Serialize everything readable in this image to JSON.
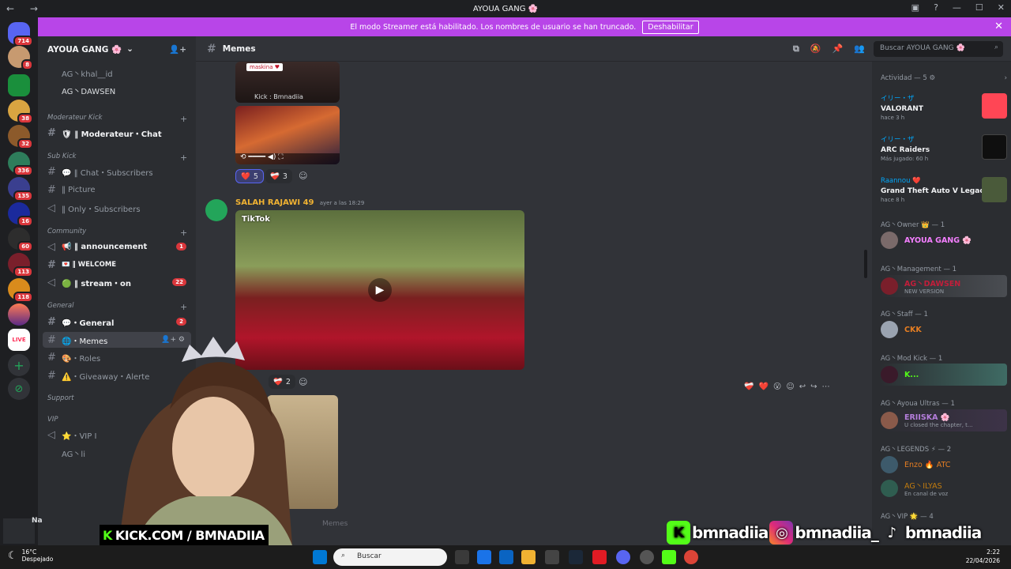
{
  "window": {
    "title": "AYOUA GANG 🌸",
    "nav": "← →",
    "controls": [
      "▣",
      "?",
      "—",
      "☐",
      "✕"
    ]
  },
  "server_badges": [
    "714",
    "8",
    "38",
    "32",
    "336",
    "135",
    "16",
    "60",
    "113",
    "118"
  ],
  "server_extras": {
    "live": "LIVE",
    "add": "+",
    "explore": "⊘"
  },
  "banner": {
    "text": "El modo Streamer está habilitado. Los nombres de usuario se han truncado.",
    "button": "Deshabilitar",
    "close": "✕"
  },
  "guild": {
    "name": "AYOUA GANG 🌸",
    "chevron": "⌄",
    "add_icon": "👤+"
  },
  "sidebar": {
    "voice_users": [
      "AG丶khal__id",
      "AG丶DAWSEN"
    ],
    "categories": [
      "Moderateur Kick",
      "Sub Kick",
      "Community",
      "General",
      "Support",
      "VIP"
    ],
    "channels": [
      {
        "label": "🛡 ‖ Moderateur・Chat"
      },
      {
        "label": "💬 ‖ Chat・Subscribers"
      },
      {
        "label": "‖ Picture"
      },
      {
        "label": "‖ Only・Subscribers"
      },
      {
        "label": "📢 ‖ announcement",
        "count": "1"
      },
      {
        "label": "💌 ‖ WELCOME"
      },
      {
        "label": "🟢 ‖ stream・on",
        "count": "22"
      },
      {
        "label": "💬・General",
        "count": "2"
      },
      {
        "label": "🌐・Memes"
      },
      {
        "label": "🎨・Roles"
      },
      {
        "label": "⚠️・Giveaway・Alerte"
      },
      {
        "label": "⭐・VIP I"
      }
    ],
    "vip_user": "AG丶li"
  },
  "channel": {
    "name": "Memes",
    "icon": "#"
  },
  "header_icons": [
    "⧉",
    "🔕",
    "📌",
    "👥"
  ],
  "search": {
    "placeholder": "Buscar AYOUA GANG 🌸"
  },
  "messages": [
    {
      "image_text_1": "maskina ♥",
      "image_text_2": "Kick : Bmnadiia",
      "reactions": [
        {
          "emoji": "❤️",
          "count": "5"
        },
        {
          "emoji": "❤️‍🩹",
          "count": "3"
        }
      ]
    },
    {
      "author": "SALAH RAJAWI 49",
      "timestamp": "ayer a las 18:29",
      "video_label": "TikTok",
      "reactions": [
        {
          "emoji": "❤️‍🩹",
          "count": "2"
        }
      ]
    }
  ],
  "message_toolbar": [
    "❤️‍🩹",
    "❤️",
    "😮",
    "☺",
    "↩",
    "↪",
    "⋯"
  ],
  "composer_hint": "Memes",
  "activity": {
    "header": "Actividad — 5",
    "items": [
      {
        "user": "イリー・ザ",
        "game": "VALORANT",
        "sub": "hace 3 h",
        "color": "#ff4655"
      },
      {
        "user": "イリー・ザ",
        "game": "ARC Raiders",
        "sub": "Más jugado: 60 h",
        "color": "#0f0f0f"
      },
      {
        "user": "Raannou ❤️",
        "game": "Grand Theft Auto V Legacy",
        "sub": "hace 8 h",
        "color": "#4a5a3a"
      }
    ]
  },
  "members": [
    {
      "section": "AG丶Owner 👑 — 1",
      "name": "AYOUA GANG 🌸",
      "status": "",
      "color": "#f47fff"
    },
    {
      "section": "AG丶Management — 1",
      "name": "AG丶DAWSEN",
      "status": "NEW VERSION",
      "color": "#c21e3a"
    },
    {
      "section": "AG丶Staff — 1",
      "name": "CKK",
      "status": "",
      "color": "#e67e22"
    },
    {
      "section": "AG丶Mod Kick — 1",
      "name": "K...",
      "status": "",
      "color": "#53fc18"
    },
    {
      "section": "AG丶Ayoua Ultras — 1",
      "name": "ERIISKA 🌸",
      "status": "U closed the chapter, t...",
      "color": "#b57edc"
    },
    {
      "section": "AG丶LEGENDS ⚡ — 2",
      "name": "Enzo 🔥 ATC",
      "status": "",
      "color": "#e67e22"
    },
    {
      "section": "",
      "name": "AG丶ILYAS",
      "status": "En canal de voz",
      "color": "#c27c0e"
    },
    {
      "section": "AG丶VIP 🌟 — 4",
      "name": "",
      "status": "",
      "color": "#949ba4"
    }
  ],
  "overlay": {
    "kick_tag": "KICK.COM / BMNADIIA",
    "handles": [
      "bmnadiia",
      "bmnadiia_",
      "bmnadiia"
    ],
    "sidebar_user": "Na"
  },
  "taskbar": {
    "temp": "16°C",
    "weather": "Despejado",
    "search": "Buscar",
    "time": "2:22",
    "date": "22/04/2026"
  }
}
